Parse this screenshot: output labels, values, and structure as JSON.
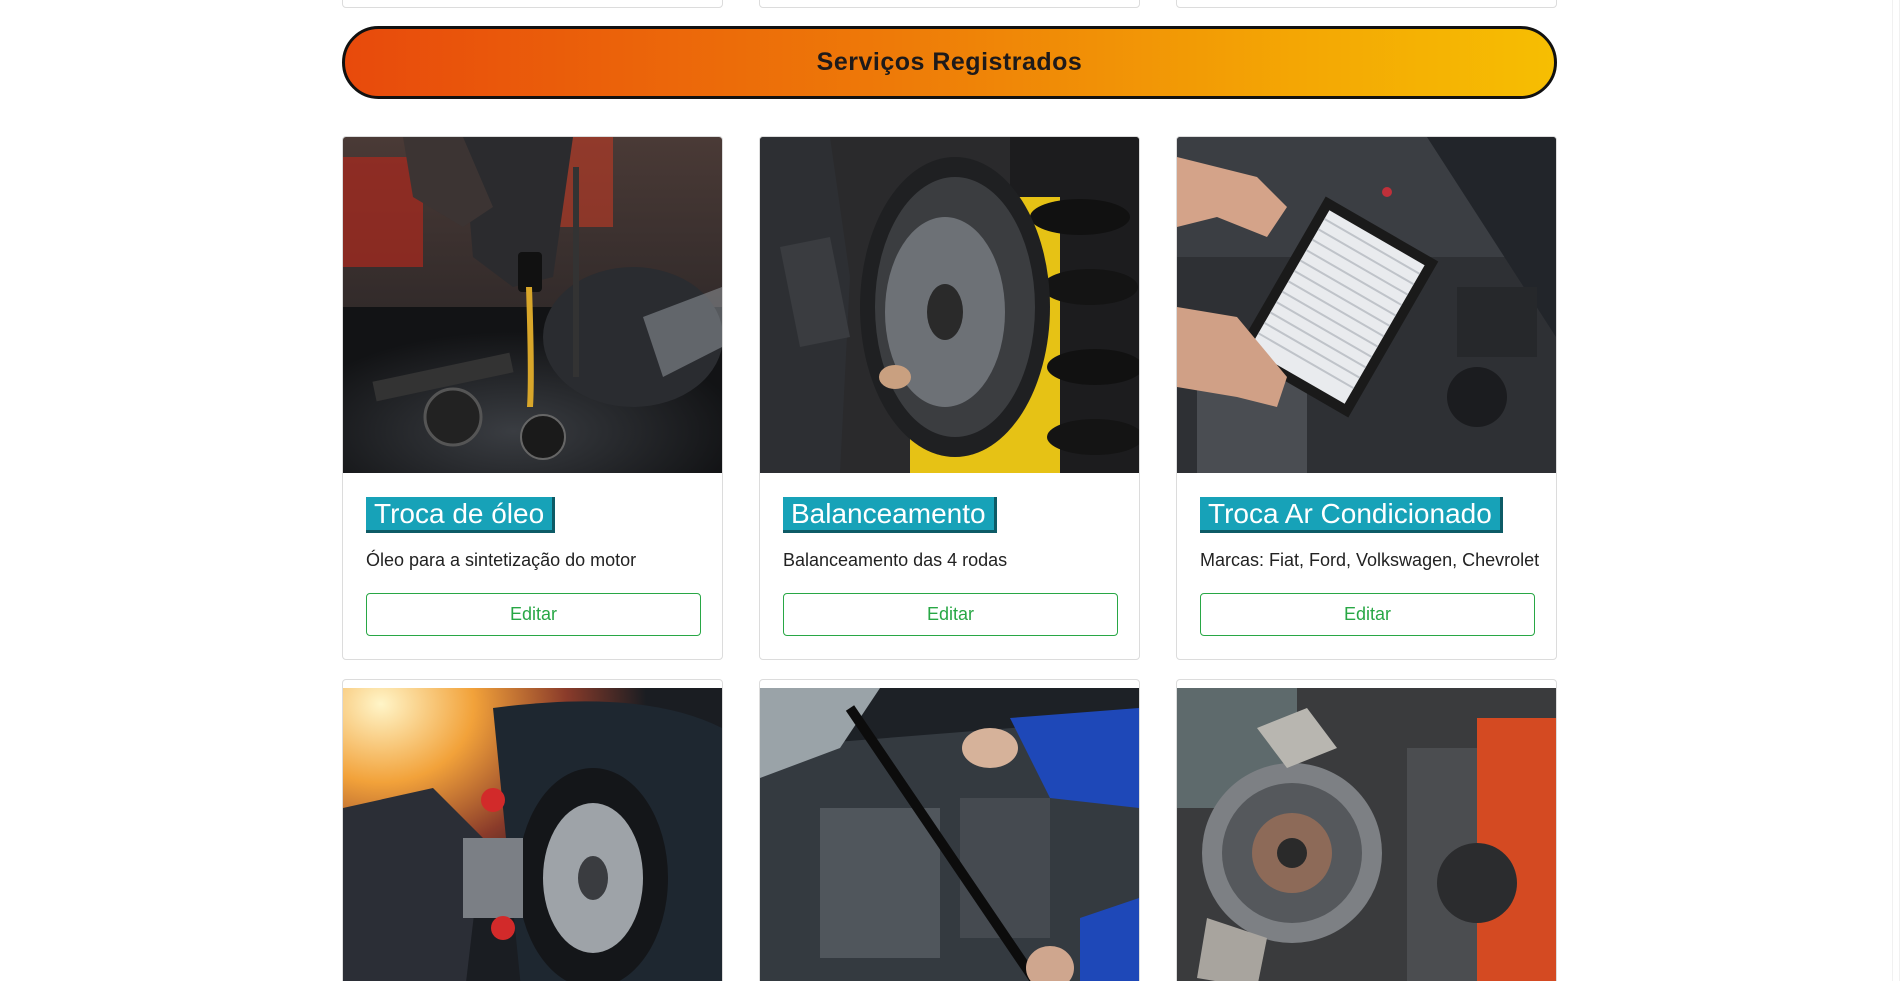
{
  "banner": {
    "title": "Serviços Registrados"
  },
  "services": [
    {
      "title": "Troca de óleo",
      "description": "Óleo para a sintetização do motor",
      "edit_label": "Editar",
      "image": "oil-change-photo"
    },
    {
      "title": "Balanceamento",
      "description": "Balanceamento das 4 rodas",
      "edit_label": "Editar",
      "image": "wheel-balancing-photo"
    },
    {
      "title": "Troca Ar Condicionado",
      "description": "Marcas: Fiat, Ford, Volkswagen, Chevrolet",
      "edit_label": "Editar",
      "image": "air-filter-photo"
    },
    {
      "image": "wheel-alignment-photo"
    },
    {
      "image": "windshield-wiper-photo"
    },
    {
      "image": "clutch-plate-photo"
    }
  ],
  "colors": {
    "banner_gradient_start": "#e84a0c",
    "banner_gradient_end": "#f6be02",
    "title_badge": "#17a2b8",
    "edit_button": "#28a745"
  }
}
